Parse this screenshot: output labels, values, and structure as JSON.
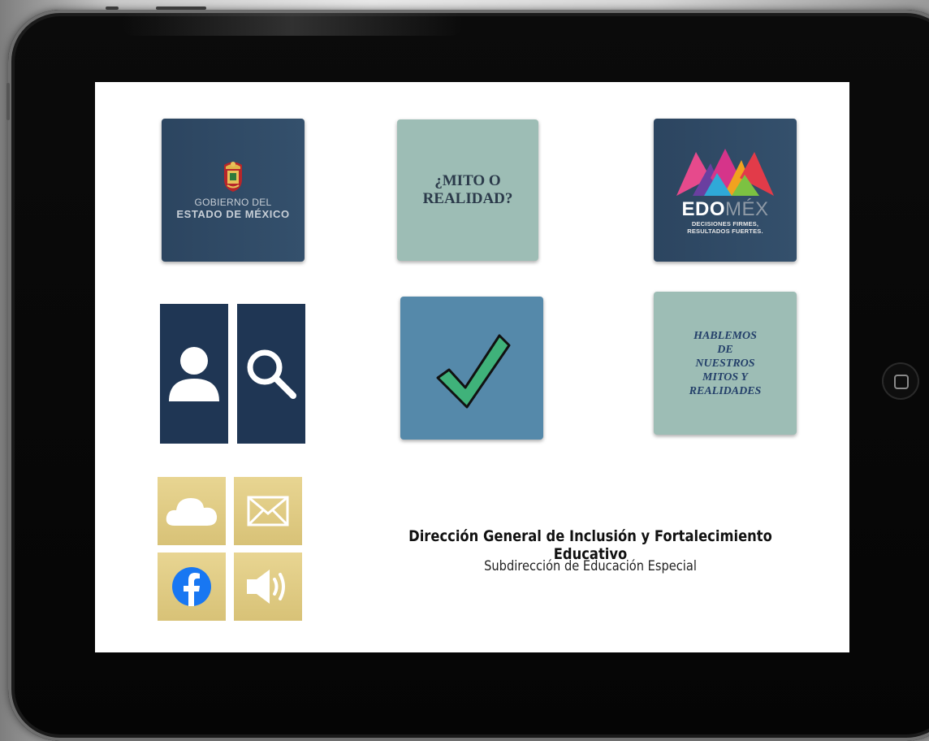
{
  "tiles": {
    "gobierno": {
      "line1": "GOBIERNO DEL",
      "line2": "ESTADO DE MÉXICO"
    },
    "mito": {
      "text": "¿MITO O\nREALIDAD?"
    },
    "edomex": {
      "word_a": "EDO",
      "word_b": "MÉX",
      "slogan_1": "DECISIONES FIRMES,",
      "slogan_2": "RESULTADOS FUERTES."
    },
    "hablemos": {
      "text": "HABLEMOS\nDE\nNUESTROS\nMITOS Y\nREALIDADES"
    }
  },
  "icons": [
    "coat-of-arms-icon",
    "person-icon",
    "magnifier-icon",
    "checkmark-icon",
    "cloud-icon",
    "mail-icon",
    "facebook-icon",
    "speaker-icon",
    "edomex-logo-icon"
  ],
  "colors": {
    "navy": "#2c4560",
    "sage": "#9dbdb5",
    "steel": "#5589aa",
    "panel": "#1f3654",
    "gold": "#e1cd86",
    "check_green": "#3fb27a"
  },
  "footer": {
    "title": "Dirección General de Inclusión y Fortalecimiento Educativo",
    "subtitle": "Subdirección de Educación Especial"
  }
}
